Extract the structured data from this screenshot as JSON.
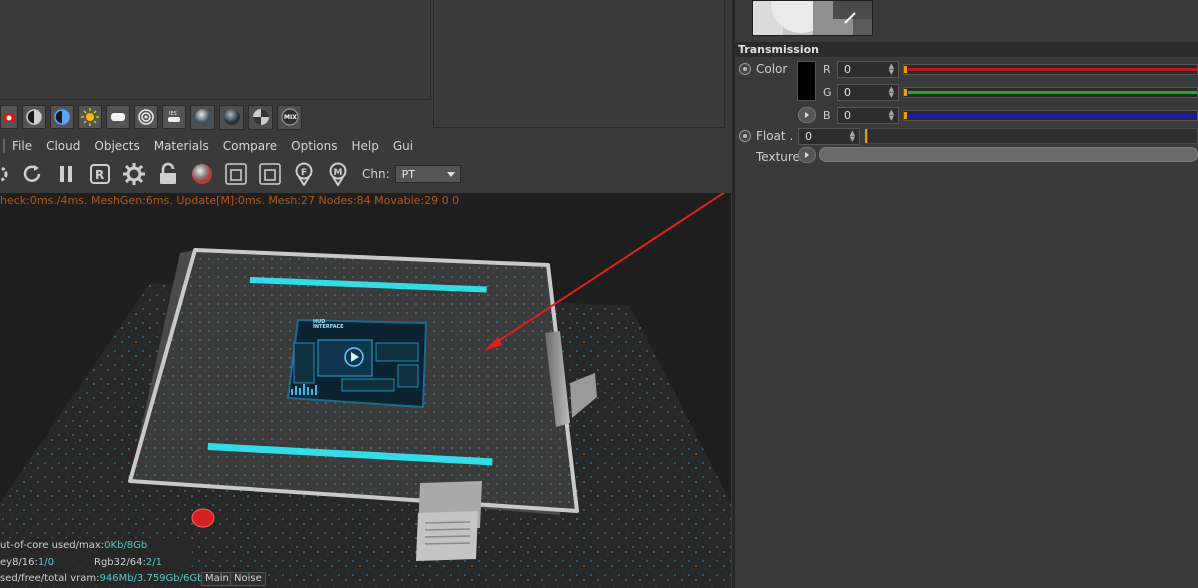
{
  "menubar": {
    "items": [
      "File",
      "Cloud",
      "Objects",
      "Materials",
      "Compare",
      "Options",
      "Help",
      "Gui"
    ]
  },
  "toolbar": {
    "channel_label": "Chn:",
    "channel_value": "PT"
  },
  "viewport": {
    "status_line": "heck:0ms./4ms. MeshGen:6ms. Update[M]:0ms. Mesh:27 Nodes:84 Movable:29  0 0",
    "screen_badge_line1": "HUD",
    "screen_badge_line2": "INTERFACE"
  },
  "stats": {
    "outofcore_label": "ut-of-core used/max:",
    "outofcore_value": "0Kb/8Gb",
    "grey_label": "ey8/16: ",
    "grey_value": "1/0",
    "rgb_label": "Rgb32/64: ",
    "rgb_value": "2/1",
    "vram_label": "sed/free/total vram: ",
    "vram_value": "946Mb/3.759Gb/6Gb"
  },
  "bottom_tabs": {
    "main": "Main",
    "noise": "Noise"
  },
  "attributes": {
    "section_title": "Transmission",
    "color_label": "Color",
    "r_label": "R",
    "r_value": "0",
    "g_label": "G",
    "g_value": "0",
    "b_label": "B",
    "b_value": "0",
    "float_label": "Float . .",
    "float_value": "0",
    "texture_label": "Texture"
  },
  "colors": {
    "accent_orange": "#e8a000",
    "status_text": "#b5561a",
    "cyan_glow": "#2fe4f0",
    "arrow_red": "#e02020"
  }
}
